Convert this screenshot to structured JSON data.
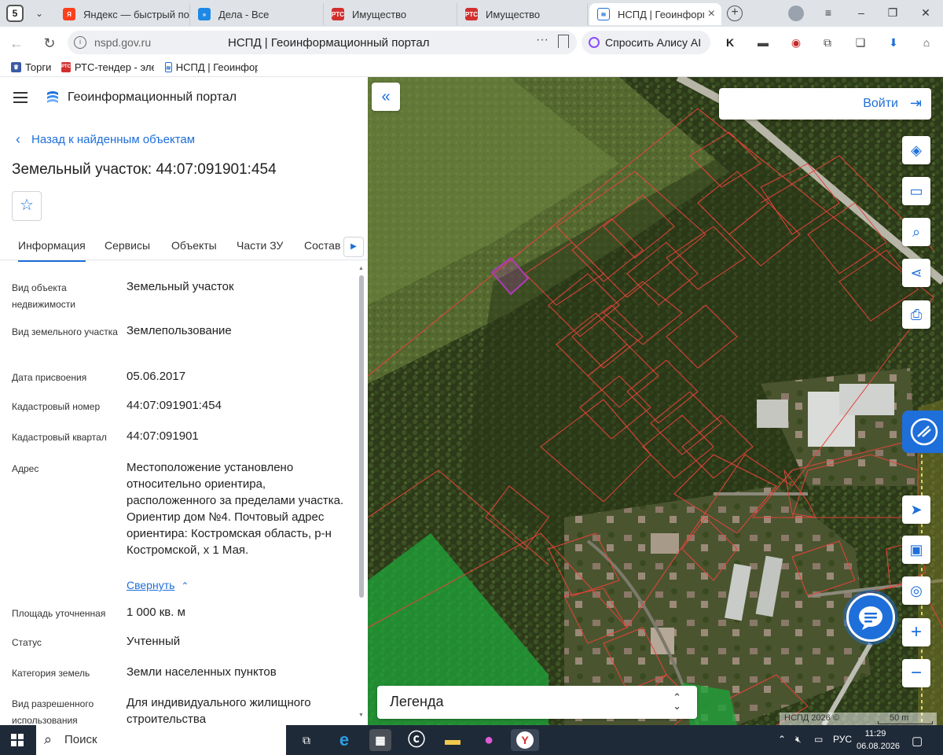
{
  "browser": {
    "tab_count": "5",
    "tabs": [
      {
        "label": "Яндекс — быстрый пои",
        "icon": "yandex-icon"
      },
      {
        "label": "Дела - Все",
        "icon": "tasks-icon"
      },
      {
        "label": "Имущество",
        "icon": "rts-icon"
      },
      {
        "label": "Имущество",
        "icon": "rts-icon"
      },
      {
        "label": "НСПД | Геоинформ",
        "icon": "nspd-icon",
        "active": true
      }
    ],
    "url_domain": "nspd.gov.ru",
    "page_title": "НСПД | Геоинформационный портал",
    "alice_label": "Спросить Алису AI",
    "bookmarks": [
      {
        "label": "Торги",
        "icon": "torgi-icon"
      },
      {
        "label": "РТС-тендер - эле",
        "icon": "rts-icon"
      },
      {
        "label": "НСПД | Геоинфор",
        "icon": "nspd-icon"
      }
    ]
  },
  "panel": {
    "portal_title": "Геоинформационный портал",
    "back_label": "Назад к найденным объектам",
    "object_title": "Земельный участок: 44:07:091901:454",
    "tabs": [
      "Информация",
      "Сервисы",
      "Объекты",
      "Части ЗУ",
      "Состав"
    ],
    "attributes": [
      {
        "key": "Вид объекта недвижимости",
        "value": "Земельный участок"
      },
      {
        "key": "Вид земельного участка",
        "value": "Землепользование"
      },
      {
        "key": "Дата присвоения",
        "value": "05.06.2017"
      },
      {
        "key": "Кадастровый номер",
        "value": "44:07:091901:454"
      },
      {
        "key": "Кадастровый квартал",
        "value": "44:07:091901"
      },
      {
        "key": "Адрес",
        "value": "Местоположение установлено относительно ориентира, расположенного за пределами участка. Ориентир дом №4. Почтовый адрес ориентира: Костромская область, р-н Костромской, х 1 Мая."
      },
      {
        "key": "Площадь уточненная",
        "value": "1 000 кв. м"
      },
      {
        "key": "Статус",
        "value": "Учтенный"
      },
      {
        "key": "Категория земель",
        "value": "Земли населенных пунктов"
      },
      {
        "key": "Вид разрешенного использования",
        "value": "Для индивидуального жилищного строительства"
      }
    ],
    "collapse_label": "Свернуть"
  },
  "map": {
    "login_label": "Войти",
    "legend_label": "Легенда",
    "attribution": "НСПД 2026 ©",
    "scale_label": "50 m",
    "colors": {
      "parcel_outline": "#e8423a",
      "selected_parcel": "#b03ab8",
      "accent": "#1e6fd9"
    }
  },
  "taskbar": {
    "search_label": "Поиск",
    "language": "РУС",
    "time": "11:29",
    "date": "06.08.2026"
  }
}
